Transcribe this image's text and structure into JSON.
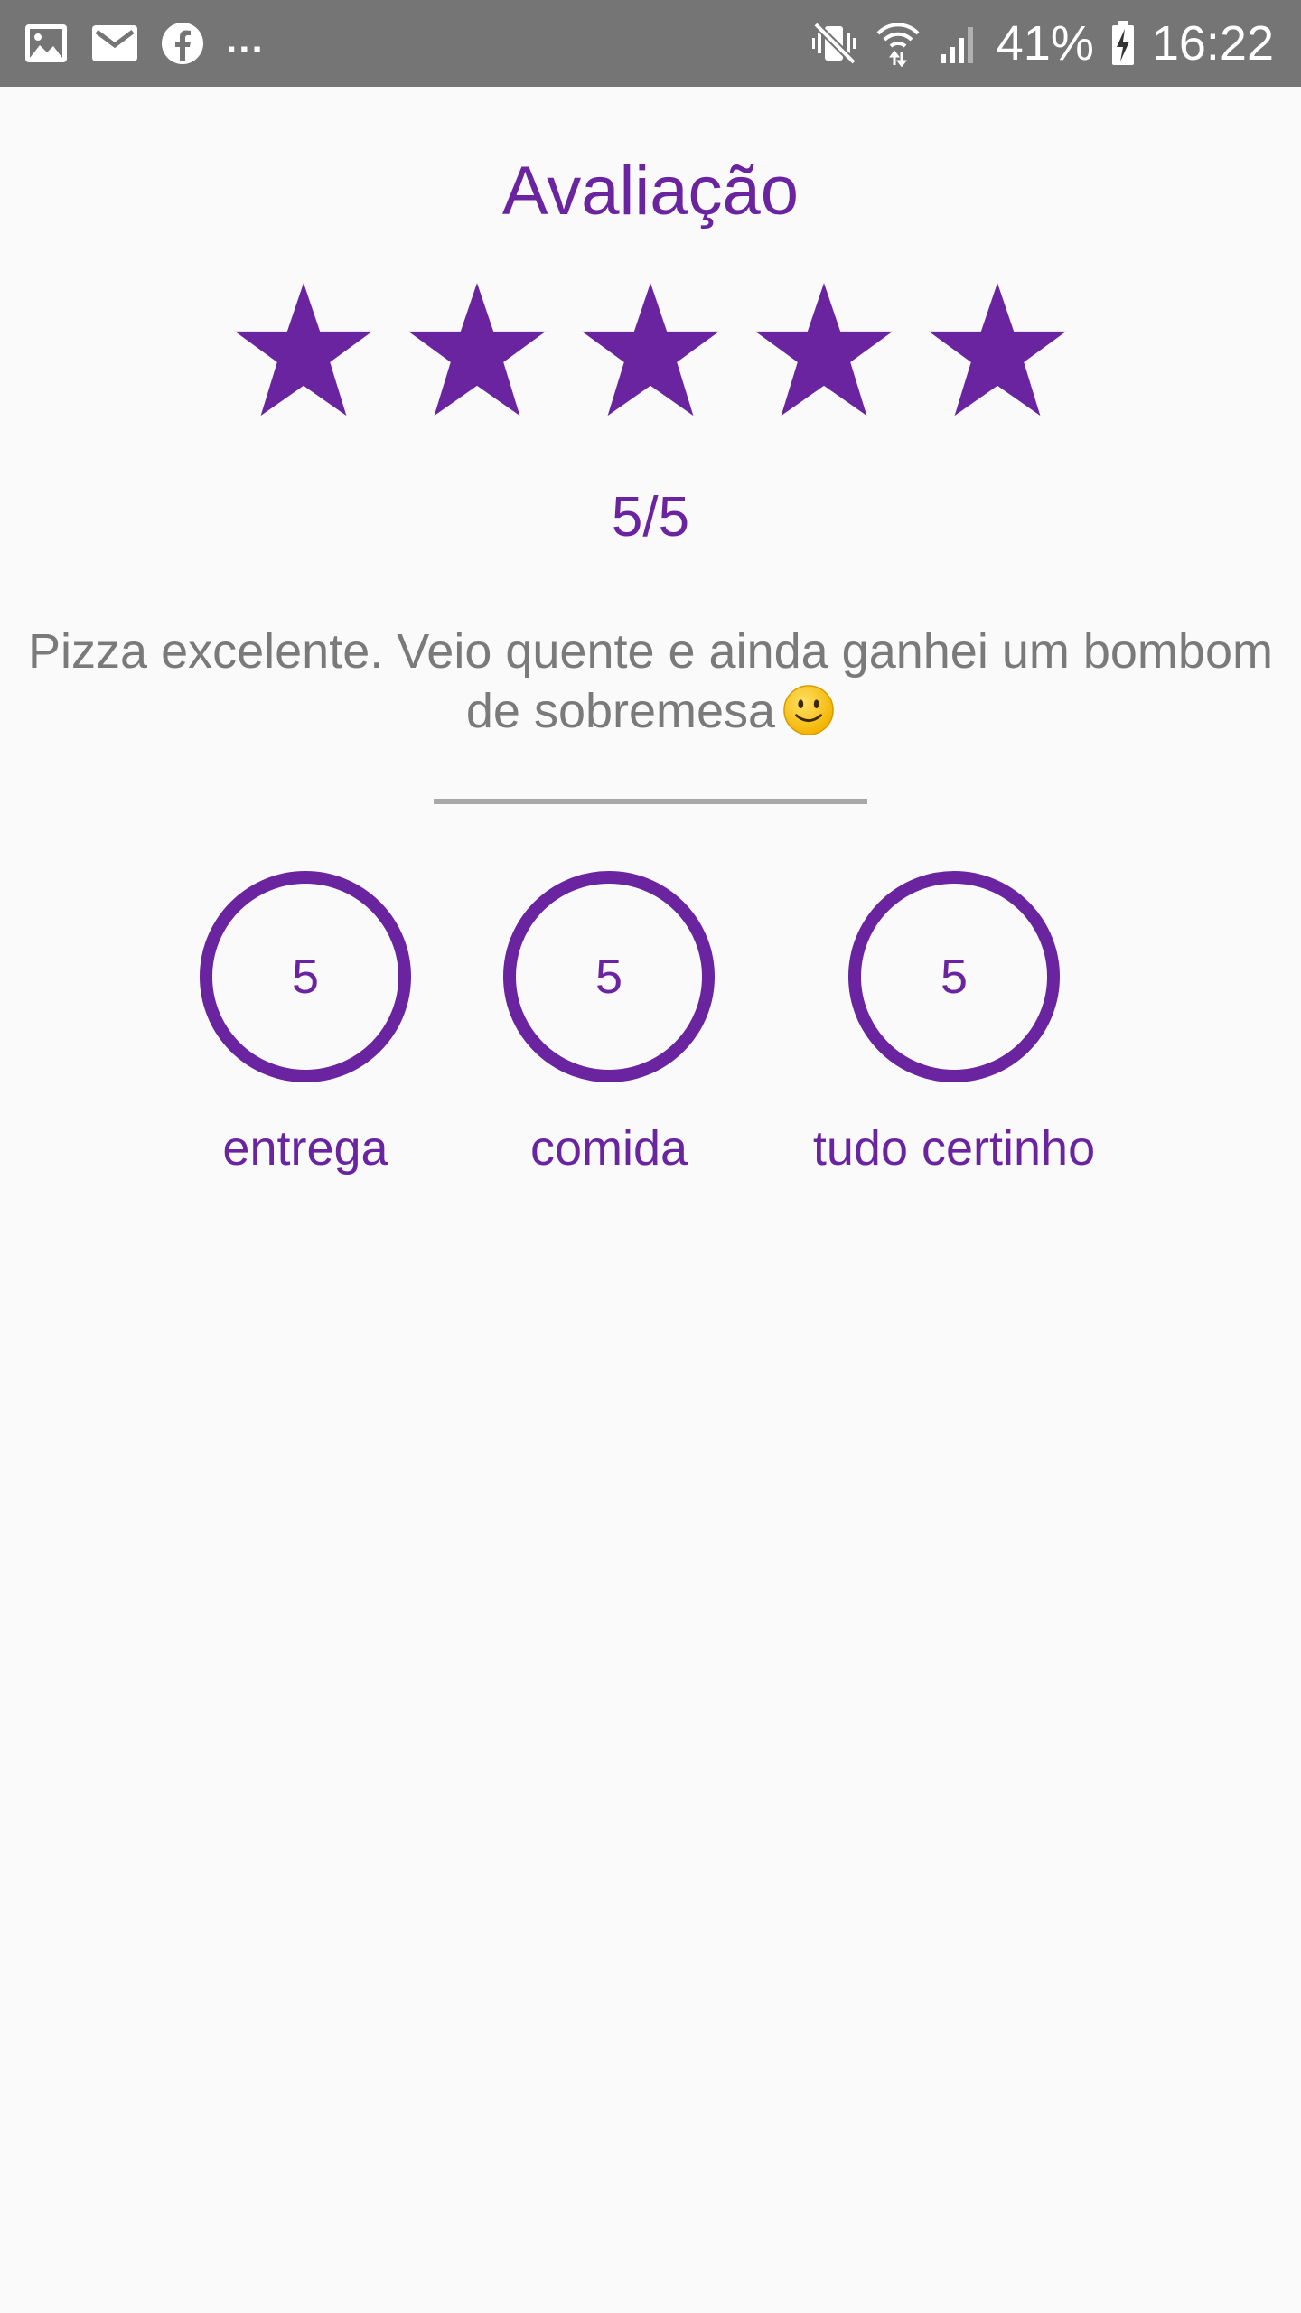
{
  "status_bar": {
    "notification_icons": [
      "image-icon",
      "mail-icon",
      "facebook-icon"
    ],
    "more_indicator": "...",
    "system_icons": [
      "vibrate-mute-icon",
      "wifi-icon",
      "signal-icon"
    ],
    "battery_percent": "41%",
    "battery_icon": "battery-charging-icon",
    "time": "16:22"
  },
  "review": {
    "title": "Avaliação",
    "rating_value": 5,
    "rating_max": 5,
    "rating_text": "5/5",
    "comment_line1": "Pizza excelente. Veio quente e ainda ganhei um bombom",
    "comment_line2": "de sobremesa",
    "comment_emoji": "smiley-face-icon"
  },
  "metrics": [
    {
      "value": "5",
      "label": "entrega"
    },
    {
      "value": "5",
      "label": "comida"
    },
    {
      "value": "5",
      "label": "tudo certinho"
    }
  ],
  "colors": {
    "accent": "#6a24a0",
    "status_bar": "#757575",
    "background": "#fafafa",
    "comment_text": "#7a7a7a",
    "divider": "#a8a8a8"
  }
}
